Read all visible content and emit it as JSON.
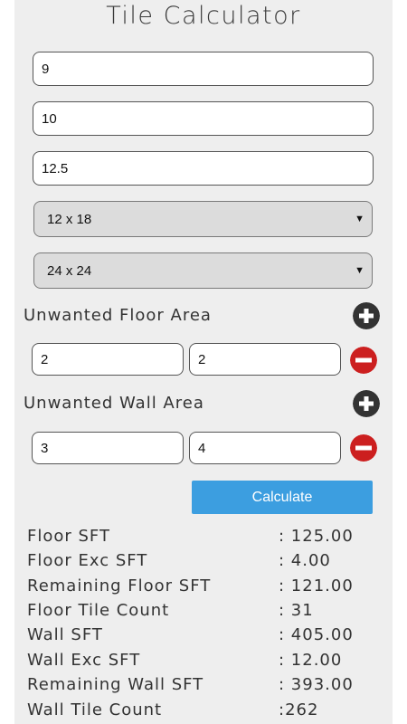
{
  "title": "Tile Calculator",
  "inputs": {
    "length": "9",
    "width": "10",
    "height": "12.5"
  },
  "selects": {
    "wall_tile_size": "12 x 18",
    "floor_tile_size": "24 x 24"
  },
  "unwanted_floor": {
    "label": "Unwanted Floor Area",
    "value1": "2",
    "value2": "2"
  },
  "unwanted_wall": {
    "label": "Unwanted Wall Area",
    "value1": "3",
    "value2": "4"
  },
  "calculate_label": "Calculate",
  "results": [
    {
      "label": "Floor SFT",
      "value": ": 125.00"
    },
    {
      "label": "Floor Exc SFT",
      "value": ": 4.00"
    },
    {
      "label": "Remaining Floor SFT",
      "value": ": 121.00"
    },
    {
      "label": "Floor Tile Count",
      "value": ": 31"
    },
    {
      "label": "Wall SFT",
      "value": ": 405.00"
    },
    {
      "label": "Wall Exc SFT",
      "value": ": 12.00"
    },
    {
      "label": "Remaining Wall SFT",
      "value": ": 393.00"
    },
    {
      "label": "Wall Tile Count",
      "value": ":262"
    }
  ],
  "colors": {
    "accent": "#3c9ee0",
    "add_icon": "#333333",
    "remove_icon": "#cc1f1f"
  },
  "icons": {
    "add": "plus-circle-icon",
    "remove": "minus-circle-icon"
  }
}
